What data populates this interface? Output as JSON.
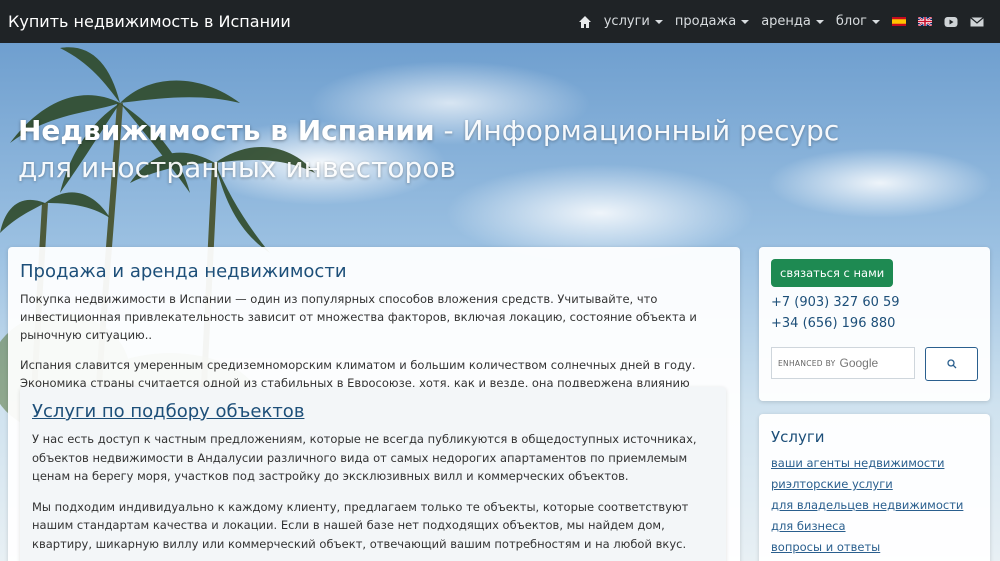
{
  "navbar": {
    "brand": "Купить недвижимость в Испании",
    "items": [
      {
        "label": "услуги"
      },
      {
        "label": "продажа"
      },
      {
        "label": "аренда"
      },
      {
        "label": "блог"
      }
    ],
    "icons": [
      "home-icon",
      "spain-flag-icon",
      "uk-flag-icon",
      "youtube-icon",
      "mail-icon"
    ]
  },
  "hero": {
    "title_bold": "Недвижимость в Испании",
    "title_rest": " - Информационный ресурс для иностранных инвесторов"
  },
  "main": {
    "heading": "Продажа и аренда недвижимости",
    "paragraphs": [
      "Покупка недвижимости в Испании — один из популярных способов вложения средств. Учитывайте, что инвестиционная привлекательность зависит от множества факторов, включая локацию, состояние объекта и рыночную ситуацию..",
      "Испания славится умеренным средиземноморским климатом и большим количеством солнечных дней в году. Экономика страны считается одной из стабильных в Евросоюзе, хотя, как и везде, она подвержена влиянию внешних факторов."
    ],
    "services_section": {
      "heading": "Услуги по подбору объектов",
      "paragraphs": [
        "У нас есть доступ к частным предложениям, которые не всегда публикуются в общедоступных источниках, объектов недвижимости в Андалусии различного вида от самых недорогих апартаментов по приемлемым ценам на берегу моря, участков под застройку до эксклюзивных вилл и коммерческих объектов.",
        "Мы подходим индивидуально к каждому клиенту, предлагаем только те объекты, которые соответствуют нашим стандартам качества и локации. Если в нашей базе нет подходящих объектов, мы найдем дом, квартиру, шикарную виллу или коммерческий объект, отвечающий вашим потребностям и на любой вкус."
      ]
    }
  },
  "sidebar": {
    "contact_button": "связаться с нами",
    "phones": [
      "+7 (903) 327 60 59",
      "+34 (656) 196 880"
    ],
    "search": {
      "enhanced_label": "ENHANCED BY",
      "google_label": "Google"
    },
    "services": {
      "heading": "Услуги",
      "links": [
        "ваши агенты недвижимости",
        "риэлторские услуги",
        "для владельцев недвижимости",
        "для бизнеса",
        "вопросы и ответы"
      ]
    }
  },
  "colors": {
    "navbar_bg": "#1f2326",
    "heading": "#1d4f79",
    "contact_button": "#1e8a52"
  }
}
